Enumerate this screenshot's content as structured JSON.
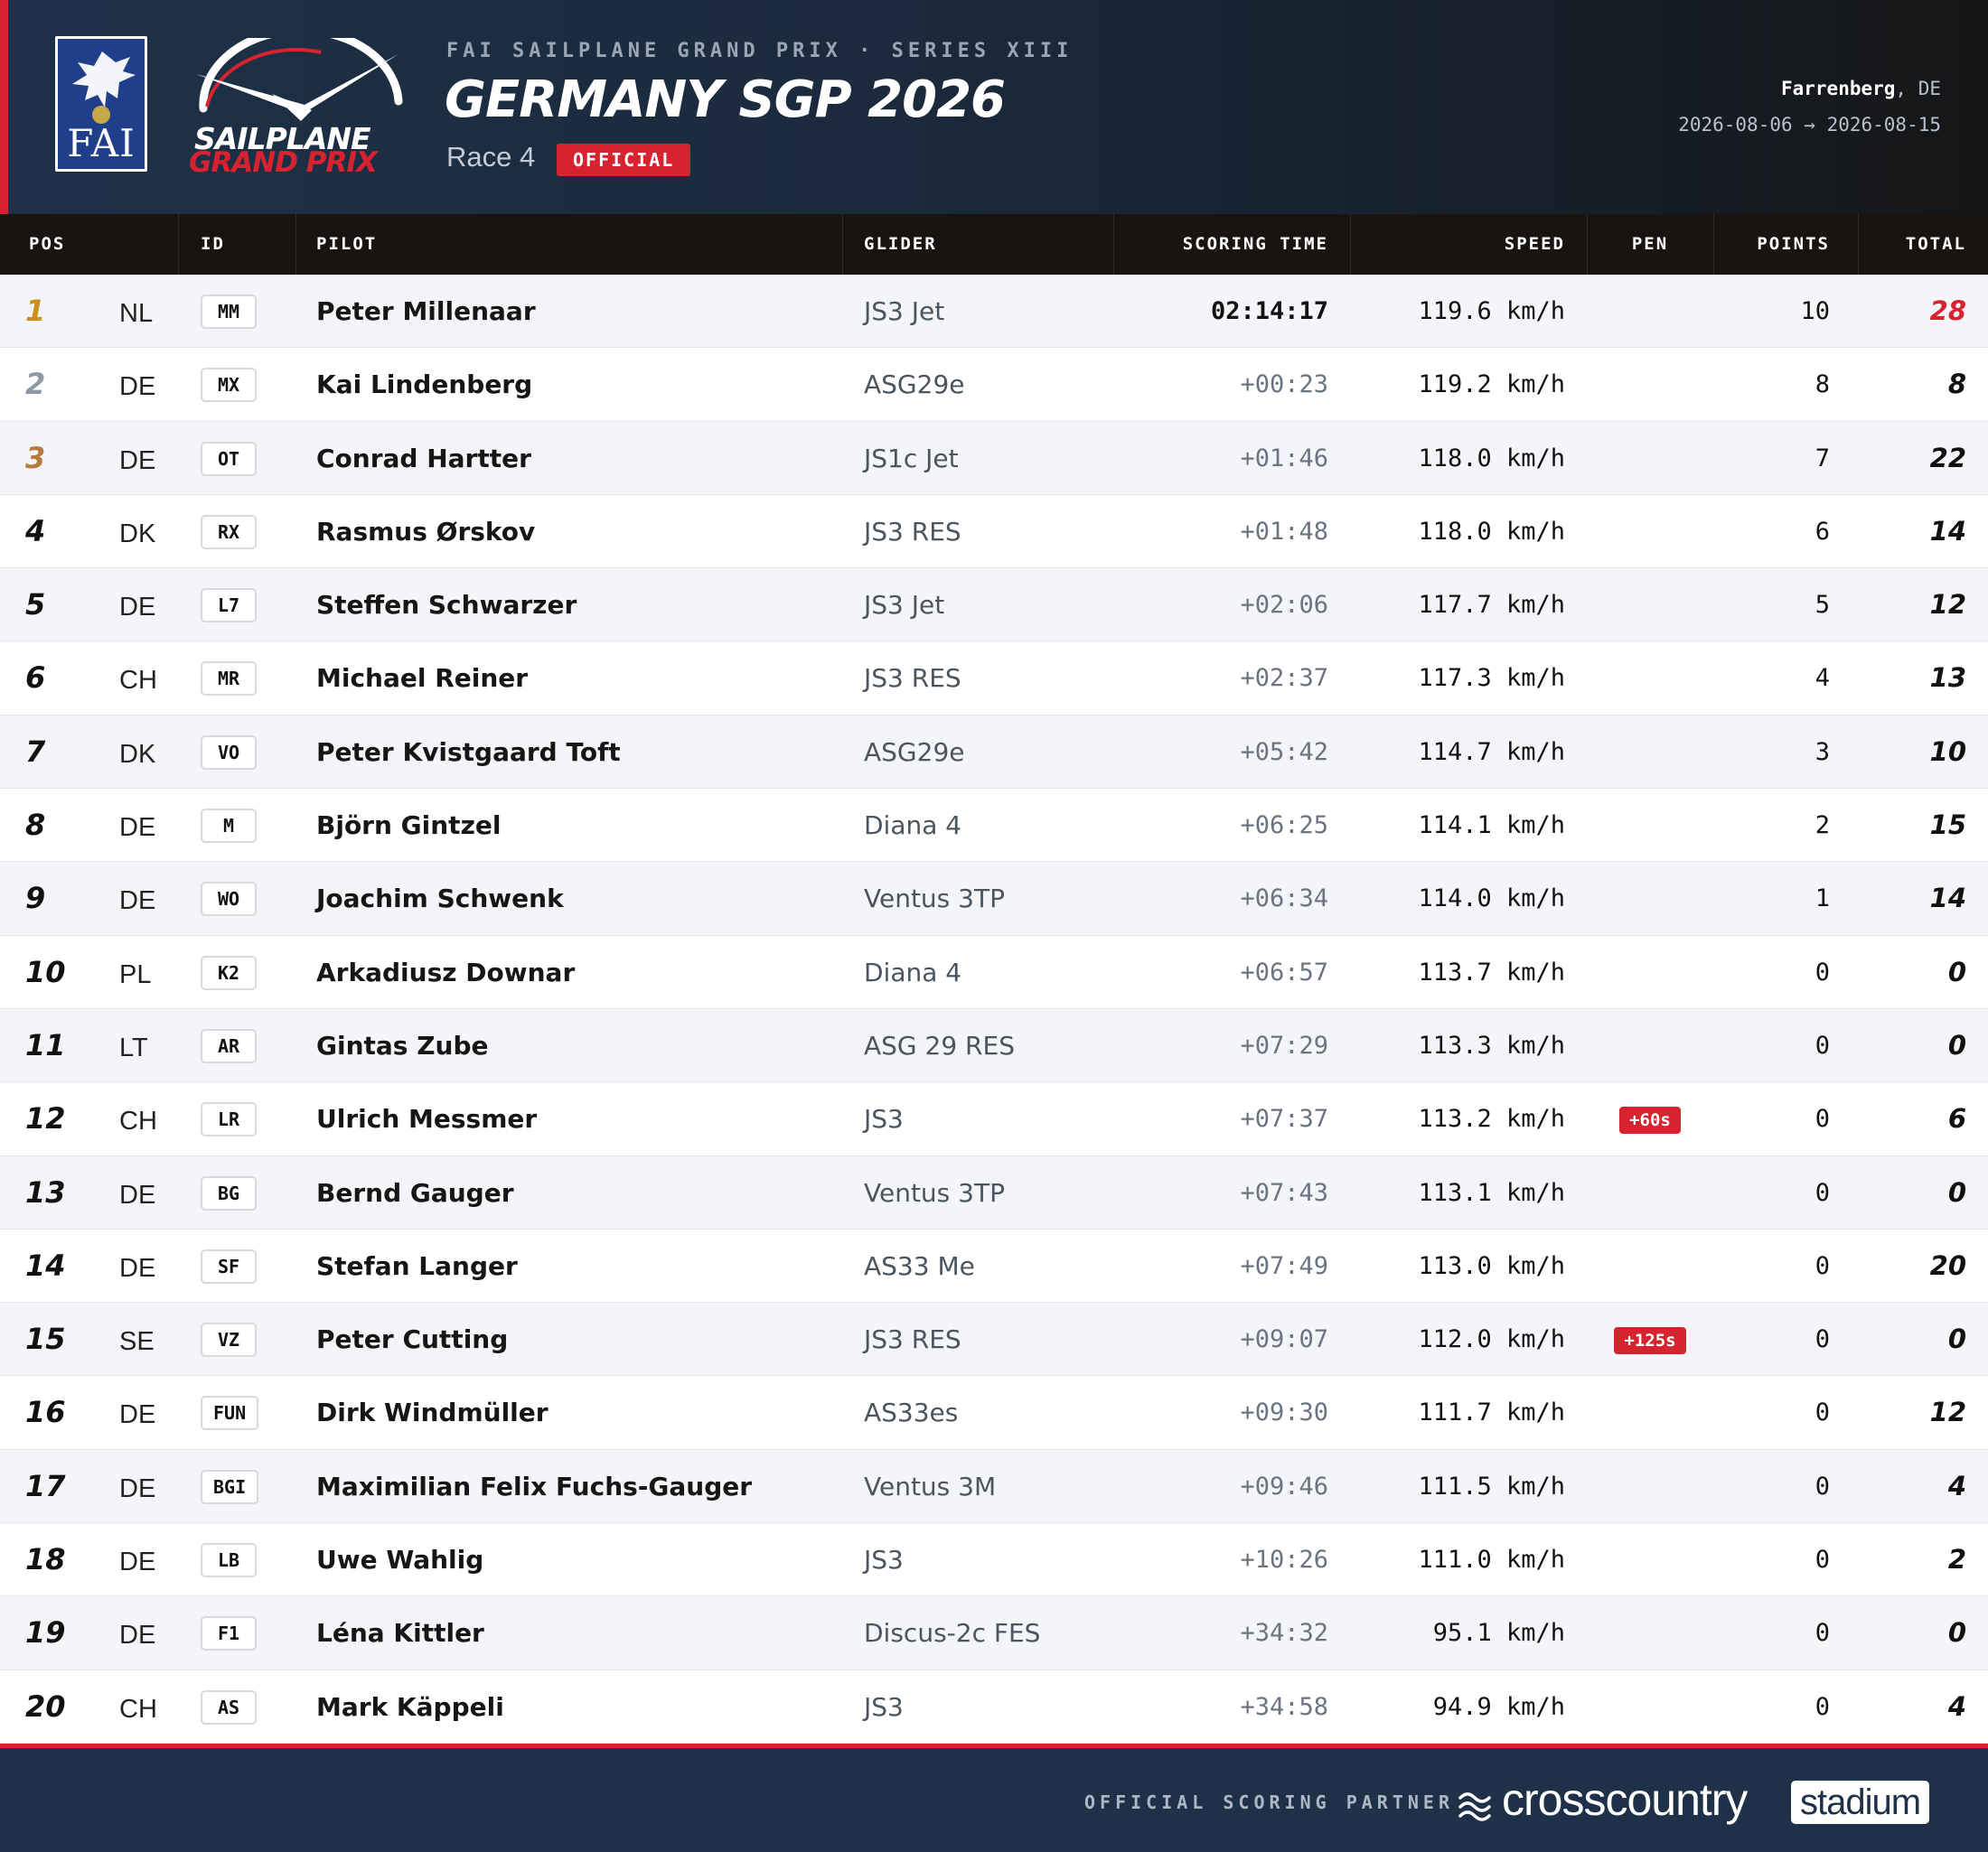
{
  "header": {
    "fai_logo_text": "FAI",
    "sgp_logo_line1": "SAILPLANE",
    "sgp_logo_line2": "GRAND PRIX",
    "series": "FAI SAILPLANE GRAND PRIX · SERIES XIII",
    "title": "GERMANY SGP 2026",
    "race": "Race 4",
    "status_badge": "OFFICIAL",
    "venue_city": "Farrenberg",
    "venue_country": ", DE",
    "dates": "2026-08-06 → 2026-08-15"
  },
  "columns": {
    "pos": "POS",
    "id": "ID",
    "pilot": "PILOT",
    "glider": "GLIDER",
    "scoring_time": "SCORING TIME",
    "speed": "SPEED",
    "pen": "PEN",
    "points": "POINTS",
    "total": "TOTAL"
  },
  "results": [
    {
      "pos": "1",
      "nat": "NL",
      "id": "MM",
      "pilot": "Peter Millenaar",
      "glider": "JS3 Jet",
      "time": "02:14:17",
      "speed": "119.6 km/h",
      "pen": "",
      "points": "10",
      "total": "28"
    },
    {
      "pos": "2",
      "nat": "DE",
      "id": "MX",
      "pilot": "Kai Lindenberg",
      "glider": "ASG29e",
      "time": "+00:23",
      "speed": "119.2 km/h",
      "pen": "",
      "points": "8",
      "total": "8"
    },
    {
      "pos": "3",
      "nat": "DE",
      "id": "OT",
      "pilot": "Conrad Hartter",
      "glider": "JS1c Jet",
      "time": "+01:46",
      "speed": "118.0 km/h",
      "pen": "",
      "points": "7",
      "total": "22"
    },
    {
      "pos": "4",
      "nat": "DK",
      "id": "RX",
      "pilot": "Rasmus Ørskov",
      "glider": "JS3 RES",
      "time": "+01:48",
      "speed": "118.0 km/h",
      "pen": "",
      "points": "6",
      "total": "14"
    },
    {
      "pos": "5",
      "nat": "DE",
      "id": "L7",
      "pilot": "Steffen Schwarzer",
      "glider": "JS3 Jet",
      "time": "+02:06",
      "speed": "117.7 km/h",
      "pen": "",
      "points": "5",
      "total": "12"
    },
    {
      "pos": "6",
      "nat": "CH",
      "id": "MR",
      "pilot": "Michael Reiner",
      "glider": "JS3 RES",
      "time": "+02:37",
      "speed": "117.3 km/h",
      "pen": "",
      "points": "4",
      "total": "13"
    },
    {
      "pos": "7",
      "nat": "DK",
      "id": "VO",
      "pilot": "Peter Kvistgaard Toft",
      "glider": "ASG29e",
      "time": "+05:42",
      "speed": "114.7 km/h",
      "pen": "",
      "points": "3",
      "total": "10"
    },
    {
      "pos": "8",
      "nat": "DE",
      "id": "M",
      "pilot": "Björn Gintzel",
      "glider": "Diana 4",
      "time": "+06:25",
      "speed": "114.1 km/h",
      "pen": "",
      "points": "2",
      "total": "15"
    },
    {
      "pos": "9",
      "nat": "DE",
      "id": "WO",
      "pilot": "Joachim Schwenk",
      "glider": "Ventus 3TP",
      "time": "+06:34",
      "speed": "114.0 km/h",
      "pen": "",
      "points": "1",
      "total": "14"
    },
    {
      "pos": "10",
      "nat": "PL",
      "id": "K2",
      "pilot": "Arkadiusz Downar",
      "glider": "Diana 4",
      "time": "+06:57",
      "speed": "113.7 km/h",
      "pen": "",
      "points": "0",
      "total": "0"
    },
    {
      "pos": "11",
      "nat": "LT",
      "id": "AR",
      "pilot": "Gintas Zube",
      "glider": "ASG 29 RES",
      "time": "+07:29",
      "speed": "113.3 km/h",
      "pen": "",
      "points": "0",
      "total": "0"
    },
    {
      "pos": "12",
      "nat": "CH",
      "id": "LR",
      "pilot": "Ulrich Messmer",
      "glider": "JS3",
      "time": "+07:37",
      "speed": "113.2 km/h",
      "pen": "+60s",
      "points": "0",
      "total": "6"
    },
    {
      "pos": "13",
      "nat": "DE",
      "id": "BG",
      "pilot": "Bernd Gauger",
      "glider": "Ventus 3TP",
      "time": "+07:43",
      "speed": "113.1 km/h",
      "pen": "",
      "points": "0",
      "total": "0"
    },
    {
      "pos": "14",
      "nat": "DE",
      "id": "SF",
      "pilot": "Stefan Langer",
      "glider": "AS33 Me",
      "time": "+07:49",
      "speed": "113.0 km/h",
      "pen": "",
      "points": "0",
      "total": "20"
    },
    {
      "pos": "15",
      "nat": "SE",
      "id": "VZ",
      "pilot": "Peter Cutting",
      "glider": "JS3 RES",
      "time": "+09:07",
      "speed": "112.0 km/h",
      "pen": "+125s",
      "points": "0",
      "total": "0"
    },
    {
      "pos": "16",
      "nat": "DE",
      "id": "FUN",
      "pilot": "Dirk Windmüller",
      "glider": "AS33es",
      "time": "+09:30",
      "speed": "111.7 km/h",
      "pen": "",
      "points": "0",
      "total": "12"
    },
    {
      "pos": "17",
      "nat": "DE",
      "id": "BGI",
      "pilot": "Maximilian Felix Fuchs-Gauger",
      "glider": "Ventus 3M",
      "time": "+09:46",
      "speed": "111.5 km/h",
      "pen": "",
      "points": "0",
      "total": "4"
    },
    {
      "pos": "18",
      "nat": "DE",
      "id": "LB",
      "pilot": "Uwe Wahlig",
      "glider": "JS3",
      "time": "+10:26",
      "speed": "111.0 km/h",
      "pen": "",
      "points": "0",
      "total": "2"
    },
    {
      "pos": "19",
      "nat": "DE",
      "id": "F1",
      "pilot": "Léna Kittler",
      "glider": "Discus-2c FES",
      "time": "+34:32",
      "speed": "95.1 km/h",
      "pen": "",
      "points": "0",
      "total": "0"
    },
    {
      "pos": "20",
      "nat": "CH",
      "id": "AS",
      "pilot": "Mark Käppeli",
      "glider": "JS3",
      "time": "+34:58",
      "speed": "94.9 km/h",
      "pen": "",
      "points": "0",
      "total": "4"
    }
  ],
  "footer": {
    "partner_label": "OFFICIAL SCORING PARTNER",
    "brand_word": "crosscountry",
    "brand_badge": "stadium"
  },
  "colors": {
    "accent_red": "#d7232f",
    "header_navy": "#1e3148",
    "table_head": "#1a1411",
    "gold": "#c8921a",
    "silver": "#8e99a6",
    "bronze": "#b57a3c"
  }
}
